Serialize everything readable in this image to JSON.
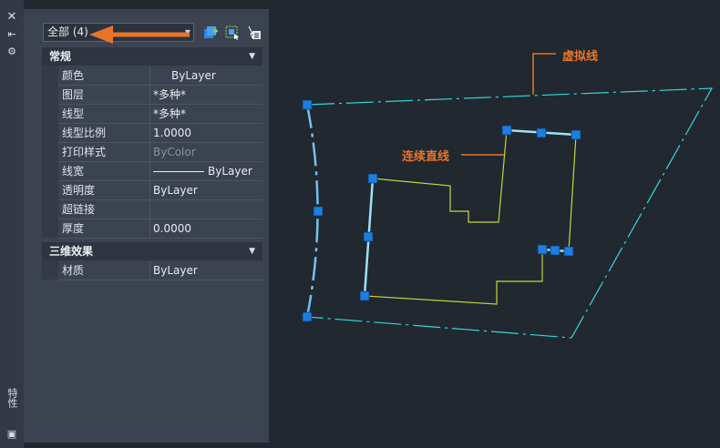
{
  "palette": {
    "select_dropdown_text": "全部 (4)"
  },
  "sections": {
    "general": {
      "title": "常规"
    },
    "threed": {
      "title": "三维效果"
    }
  },
  "props": [
    {
      "key": "颜色",
      "value": "ByLayer"
    },
    {
      "key": "图层",
      "value": "*多种*"
    },
    {
      "key": "线型",
      "value": "*多种*"
    },
    {
      "key": "线型比例",
      "value": "1.0000"
    },
    {
      "key": "打印样式",
      "value": "ByColor"
    },
    {
      "key": "线宽",
      "value": "ByLayer"
    },
    {
      "key": "透明度",
      "value": "ByLayer"
    },
    {
      "key": "超链接",
      "value": ""
    },
    {
      "key": "厚度",
      "value": "0.0000"
    }
  ],
  "props3d": [
    {
      "key": "材质",
      "value": "ByLayer"
    }
  ],
  "side_title": "特性",
  "annotations": {
    "virtual_line": "虚拟线",
    "continuous_line": "连续直线"
  },
  "colors": {
    "accent_arrow": "#e8742a",
    "cyan_line": "#36d6dc",
    "yellow_line": "#c8d53a",
    "grip": "#1e7ee0"
  }
}
